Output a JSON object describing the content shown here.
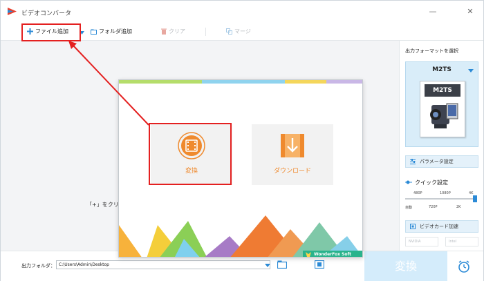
{
  "app": {
    "title": "ビデオコンバータ"
  },
  "window_controls": {
    "minimize": "—",
    "close": "✕"
  },
  "toolbar": {
    "add_file": "ファイル追加",
    "add_folder": "フォルダ追加",
    "clear": "クリア",
    "merge": "マージ"
  },
  "main": {
    "hint": "「+」をクリッ"
  },
  "right_panel": {
    "output_format_label": "出力フォーマットを選択",
    "selected_format": "M2TS",
    "format_card_label": "M2TS",
    "param_settings": "パラメータ設定",
    "quick_settings": "クイック設定",
    "quality_top": [
      "480P",
      "1080P",
      "4K"
    ],
    "quality_bottom": [
      "自動",
      "720P",
      "2K"
    ],
    "gpu_accel": "ビデオカード加速",
    "gpu_badges": [
      "NVIDIA",
      "Intel"
    ]
  },
  "bottom": {
    "output_folder_label": "出力フォルダ：",
    "output_folder_value": "C:\\Users\\Admin\\Desktop",
    "convert_button": "変換"
  },
  "popup": {
    "convert_label": "変換",
    "download_label": "ダウンロード",
    "brand": "WonderFox Soft"
  },
  "colors": {
    "accent": "#2b8ad6",
    "highlight_red": "#e42020",
    "tile_orange": "#ef8a2e",
    "convert_button_bg": "#d4ecfb"
  },
  "icons": {
    "app_logo": "app-logo-icon",
    "add_file": "plus-icon",
    "add_folder": "folder-icon",
    "clear": "trash-icon",
    "merge": "merge-icon",
    "convert_tile": "film-icon",
    "download_tile": "download-icon",
    "alarm": "alarm-clock-icon"
  }
}
